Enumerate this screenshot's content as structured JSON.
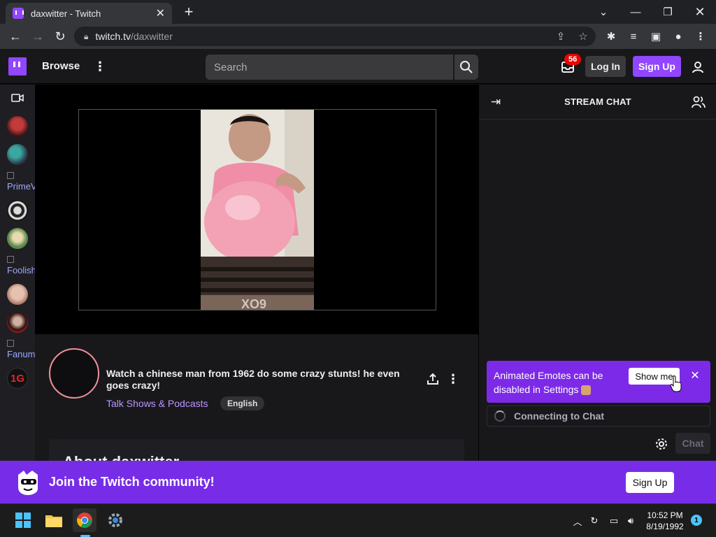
{
  "browser": {
    "tab_title": "daxwitter - Twitch",
    "url_host": "twitch.tv",
    "url_path": "/daxwitter"
  },
  "topnav": {
    "browse_label": "Browse",
    "search_placeholder": "Search",
    "inbox_count": "56",
    "login_label": "Log In",
    "signup_label": "Sign Up"
  },
  "sidenav": {
    "broken_images": [
      "PrimeV",
      "Foolish",
      "Fanum"
    ]
  },
  "stream": {
    "title": "Watch a chinese man from 1962 do some crazy stunts! he even goes crazy!",
    "category": "Talk Shows & Podcasts",
    "tag": "English",
    "about_heading": "About daxwitter",
    "video_caption": "XO9"
  },
  "chat": {
    "header": "STREAM CHAT",
    "emote_banner_text": "Animated Emotes can be disabled in Settings",
    "show_me_label": "Show me",
    "connecting_text": "Connecting to Chat",
    "chat_button_label": "Chat"
  },
  "join_banner": {
    "text": "Join the Twitch community!",
    "signup_label": "Sign Up"
  },
  "taskbar": {
    "time": "10:52 PM",
    "date": "8/19/1992",
    "notification_count": "1"
  },
  "colors": {
    "twitch_purple": "#9146ff",
    "banner_purple": "#772ce8",
    "badge_red": "#eb0400"
  }
}
